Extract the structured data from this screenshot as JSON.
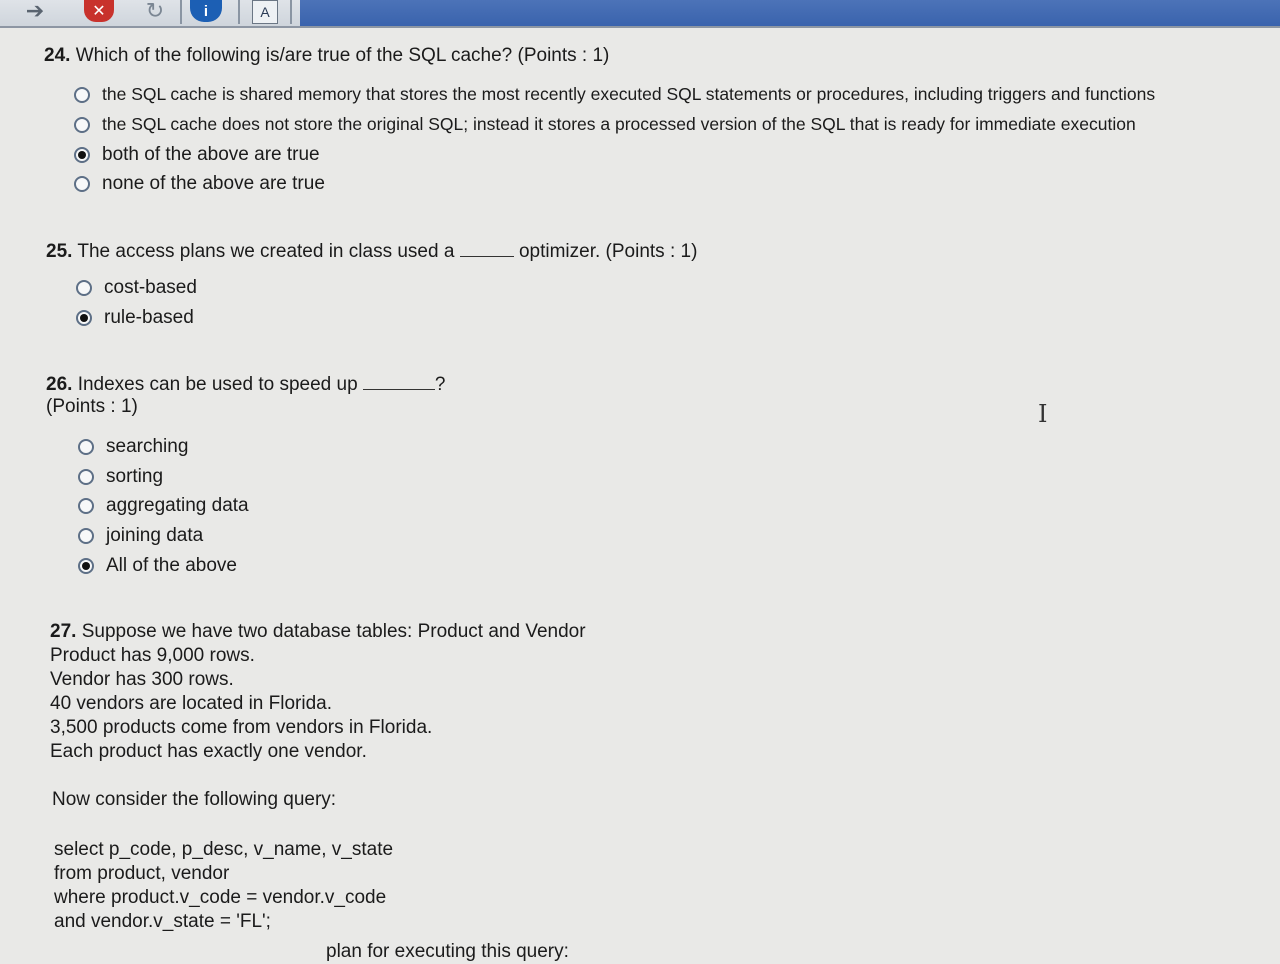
{
  "toolbar": {
    "back_icon": "arrow-icon",
    "close_symbol": "✕",
    "refresh_symbol": "↻",
    "info_symbol": "i",
    "a_label": "A"
  },
  "q24": {
    "number": "24.",
    "text": "Which of the following is/are true of the SQL cache? (Points : 1)",
    "options": [
      {
        "label": "the SQL cache is shared memory that stores the most recently executed SQL statements or procedures, including triggers and functions",
        "selected": false
      },
      {
        "label": "the SQL cache does not store the original SQL; instead it stores a processed version of the SQL that is ready for immediate execution",
        "selected": false
      },
      {
        "label": "both of the above are true",
        "selected": true
      },
      {
        "label": "none of the above are true",
        "selected": false
      }
    ]
  },
  "q25": {
    "number": "25.",
    "text_before": "The access plans we created in class used a",
    "text_after": "optimizer. (Points : 1)",
    "options": [
      {
        "label": "cost-based",
        "selected": false
      },
      {
        "label": "rule-based",
        "selected": true
      }
    ]
  },
  "q26": {
    "number": "26.",
    "text_before": "Indexes can be used to speed up",
    "text_after": "?",
    "points": "(Points : 1)",
    "options": [
      {
        "label": "searching",
        "selected": false
      },
      {
        "label": "sorting",
        "selected": false
      },
      {
        "label": "aggregating data",
        "selected": false
      },
      {
        "label": "joining data",
        "selected": false
      },
      {
        "label": "All of the above",
        "selected": true
      }
    ]
  },
  "q27": {
    "number": "27.",
    "lines": [
      "Suppose we have two database tables:  Product and Vendor",
      "Product has 9,000 rows.",
      "Vendor has 300 rows.",
      "40 vendors are located in Florida.",
      "3,500 products come from vendors in Florida.",
      "Each product has exactly one vendor."
    ],
    "consider": "Now consider the following query:",
    "query": [
      "select p_code, p_desc, v_name, v_state",
      "from product, vendor",
      "where product.v_code = vendor.v_code",
      "and vendor.v_state = 'FL';"
    ],
    "cut_line": "plan for executing this query:"
  }
}
